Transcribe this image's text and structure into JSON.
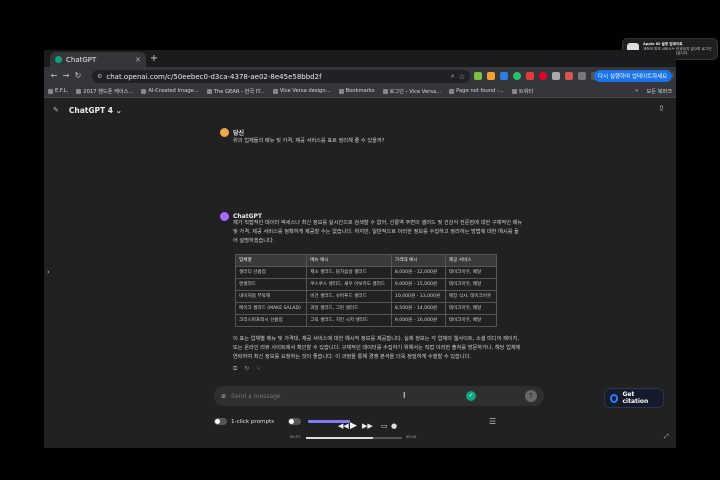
{
  "notification": {
    "title": "Apple ID 설정 업데이트",
    "body": "계정의 일부 서비스는 보호되지 않으며 로그인해 데이터 사용할 수 없습니다."
  },
  "browser": {
    "tab_title": "ChatGPT",
    "url": "chat.openai.com/c/50eebec0-d3ca-4378-ae02-8e45e58bbd2f",
    "update_button": "다시 실행하여 업데이트하세요",
    "bookmarks": [
      "E.F.L.",
      "2017 핸드폰 케이스...",
      "AI-Created Image...",
      "The GEAR - 한국 IT...",
      "Vice Versa design...",
      "Bookmarks",
      "로그인 ‹ Vice Versa...",
      "Page not found -...",
      "트위터"
    ],
    "bookmarks_more": "»",
    "all_bookmarks": "모든 북마크"
  },
  "chat": {
    "model": "ChatGPT 4",
    "user_name": "당신",
    "user_message": "위의 업체들의 메뉴 및 가격, 제공 서비스를 표로 정리해 줄 수 있을까?",
    "assistant_name": "ChatGPT",
    "assistant_intro": "제가 직접적인 데이터 액세스나 최신 정보를 실시간으로 검색할 수 없어, 선릉역 주변의 샐러드 및 건강식 전문점에 대한 구체적인 메뉴 및 가격, 제공 서비스를 정확하게 제공할 수는 없습니다. 하지만, 일반적으로 이러한 정보를 수집하고 정리하는 방법에 대한 예시를 들어 설명하겠습니다.",
    "table": {
      "headers": [
        "업체명",
        "메뉴 예시",
        "가격대 예시",
        "제공 서비스"
      ],
      "rows": [
        [
          "샐러디 선릉점",
          "제소 샐러드, 닭가슴살 샐러드",
          "8,000원 - 12,000원",
          "테이크아웃, 배달"
        ],
        [
          "엔샐러드",
          "쿠스쿠스 샐러드, 새우 아보카도 샐러드",
          "9,000원 - 15,000원",
          "테이크아웃, 배달"
        ],
        [
          "내이처럼 부탁해",
          "비건 샐러드, 슈퍼푸드 샐러드",
          "10,000원 - 13,000원",
          "매장 식사, 테이크아웃"
        ],
        [
          "메이크 샐러드 (MAKE SALAD)",
          "과일 샐러드, 그린 샐러드",
          "8,500원 - 14,000원",
          "테이크아웃, 배달"
        ],
        [
          "크리스피프레시 선릉점",
          "그릭 샐러드, 치킨 시저 샐러드",
          "9,000원 - 16,000원",
          "테이크아웃, 배달"
        ]
      ]
    },
    "assistant_outro": "이 표는 업체별 메뉴 및 가격대, 제공 서비스에 대한 예시적 정보를 제공합니다. 실제 정보는 각 업체의 웹사이트, 소셜 미디어 페이지, 또는 온라인 리뷰 사이트에서 확인할 수 있습니다. 구체적인 데이터를 수집하기 위해서는 직접 이러한 출처를 방문하거나, 해당 업체에 연락하여 최신 정보를 요청하는 것이 좋습니다. 이 과정을 통해 경쟁 분석을 더욱 정밀하게 수행할 수 있습니다.",
    "composer_placeholder": "Send a message"
  },
  "extensions": {
    "citation_label": "Get citation",
    "one_click_label": "1-click prompts",
    "player_time_start": "00:57",
    "player_time_end": "00:16",
    "player_progress": 0.7
  }
}
